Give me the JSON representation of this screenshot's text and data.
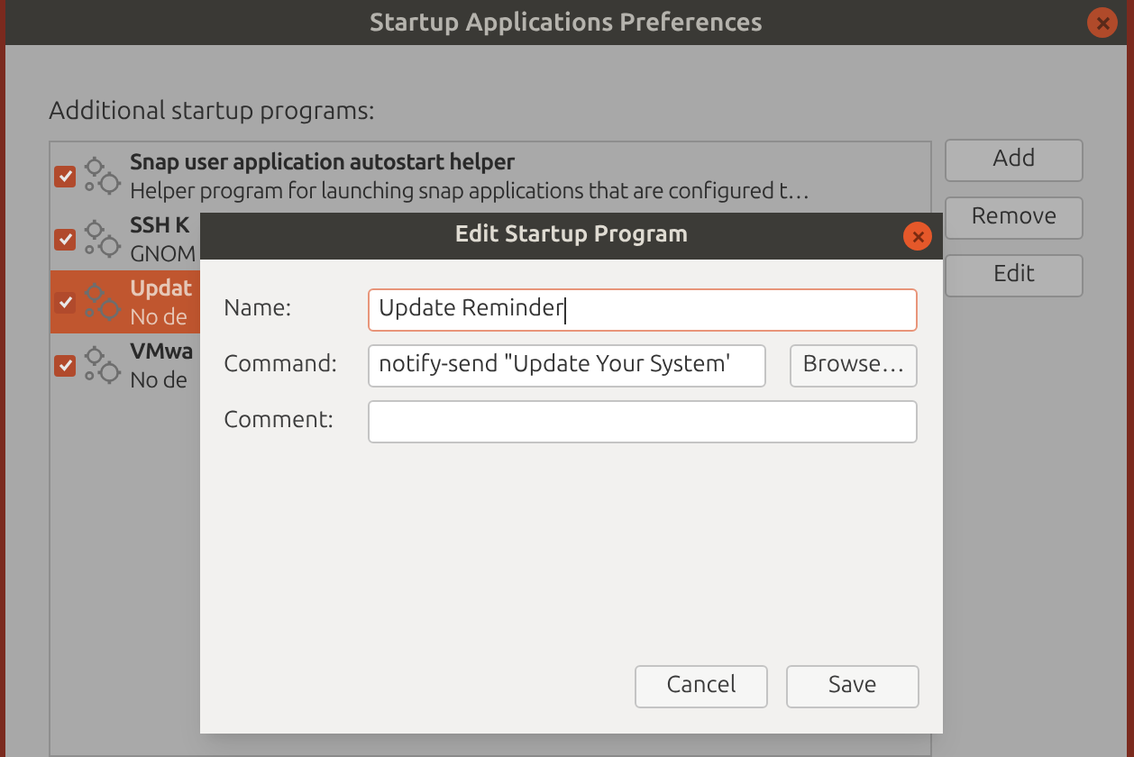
{
  "window": {
    "title": "Startup Applications Preferences"
  },
  "list_label": "Additional startup programs:",
  "programs": [
    {
      "name": "Snap user application autostart helper",
      "description": "Helper program for launching snap applications that are configured t…",
      "enabled": true,
      "selected": false
    },
    {
      "name": "SSH K",
      "description": "GNOM",
      "enabled": true,
      "selected": false
    },
    {
      "name": "Updat",
      "description": "No de",
      "enabled": true,
      "selected": true
    },
    {
      "name": "VMwa",
      "description": "No de",
      "enabled": true,
      "selected": false
    }
  ],
  "side_buttons": [
    "Add",
    "Remove",
    "Edit"
  ],
  "dialog": {
    "title": "Edit Startup Program",
    "fields": [
      {
        "label": "Name:",
        "value": "Update Reminder",
        "focused": true
      },
      {
        "label": "Command:",
        "value": "notify-send \"Update Your System'",
        "focused": false,
        "browse": "Browse…"
      },
      {
        "label": "Comment:",
        "focused": false
      }
    ],
    "buttons": [
      "Cancel",
      "Save"
    ]
  }
}
